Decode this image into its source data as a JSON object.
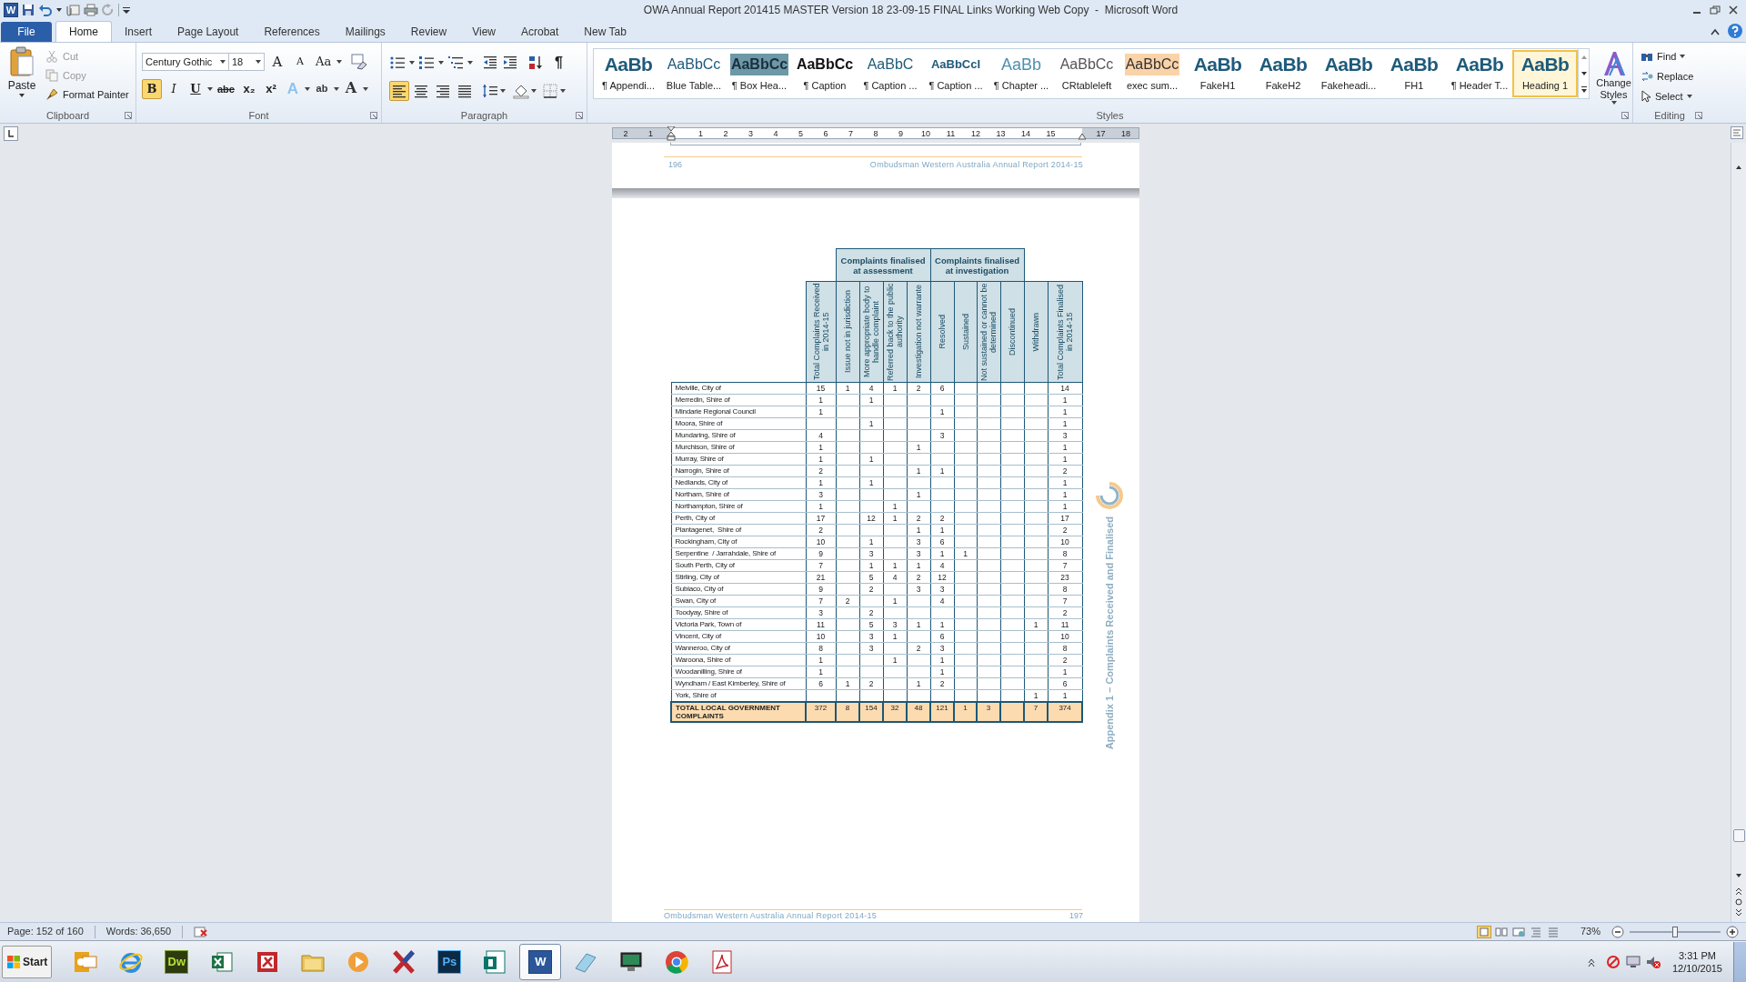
{
  "window": {
    "title": "OWA Annual Report 201415 MASTER Version 18 23-09-15 FINAL Links Working Web Copy  -  Microsoft Word",
    "app_glyph": "W"
  },
  "ribbon_tabs": [
    {
      "label": "File",
      "kind": "file",
      "selected": false
    },
    {
      "label": "Home",
      "kind": "tab",
      "selected": true
    },
    {
      "label": "Insert",
      "kind": "tab",
      "selected": false
    },
    {
      "label": "Page Layout",
      "kind": "tab",
      "selected": false
    },
    {
      "label": "References",
      "kind": "tab",
      "selected": false
    },
    {
      "label": "Mailings",
      "kind": "tab",
      "selected": false
    },
    {
      "label": "Review",
      "kind": "tab",
      "selected": false
    },
    {
      "label": "View",
      "kind": "tab",
      "selected": false
    },
    {
      "label": "Acrobat",
      "kind": "tab",
      "selected": false
    },
    {
      "label": "New Tab",
      "kind": "tab",
      "selected": false
    }
  ],
  "clipboard": {
    "label": "Clipboard",
    "paste": "Paste",
    "cut": "Cut",
    "copy": "Copy",
    "format_painter": "Format Painter"
  },
  "font": {
    "label": "Font",
    "name": "Century Gothic",
    "size": "18",
    "buttons": [
      {
        "kind": "grow",
        "label": "A",
        "on": false
      },
      {
        "kind": "shrink",
        "label": "A",
        "on": false
      },
      {
        "kind": "case",
        "label": "Aa",
        "on": false
      },
      {
        "kind": "bold",
        "label": "B",
        "on": true
      },
      {
        "kind": "italic",
        "label": "I",
        "on": false
      },
      {
        "kind": "underline",
        "label": "U",
        "on": false
      },
      {
        "kind": "strike",
        "label": "abc",
        "on": false
      },
      {
        "kind": "sub",
        "label": "x₂",
        "on": false
      },
      {
        "kind": "sup",
        "label": "x²",
        "on": false
      },
      {
        "kind": "effects",
        "label": "A",
        "on": false
      },
      {
        "kind": "highlight",
        "label": "ab",
        "on": false
      },
      {
        "kind": "color",
        "label": "A",
        "on": false
      }
    ]
  },
  "paragraph": {
    "label": "Paragraph",
    "pilcrow": "¶",
    "alignments": [
      {
        "kind": "left",
        "selected": true
      },
      {
        "kind": "center",
        "selected": false
      },
      {
        "kind": "right",
        "selected": false
      },
      {
        "kind": "justify",
        "selected": false
      }
    ]
  },
  "styles": {
    "label": "Styles",
    "change_styles": "Change Styles",
    "items": [
      {
        "preview": "AaBb",
        "name": "¶ Appendi...",
        "kind": "heading",
        "selected": false
      },
      {
        "preview": "AaBbCc",
        "name": "Blue Table...",
        "kind": "blue",
        "selected": false
      },
      {
        "preview": "AaBbCc",
        "name": "¶ Box Hea...",
        "kind": "box",
        "selected": false
      },
      {
        "preview": "AaBbCc",
        "name": "¶ Caption",
        "kind": "black",
        "selected": false
      },
      {
        "preview": "AaBbC",
        "name": "¶ Caption ...",
        "kind": "blue",
        "selected": false
      },
      {
        "preview": "AaBbCcI",
        "name": "¶ Caption ...",
        "kind": "small",
        "selected": false
      },
      {
        "preview": "AaBb",
        "name": "¶ Chapter ...",
        "kind": "light",
        "selected": false
      },
      {
        "preview": "AaBbCc",
        "name": "CRtableleft",
        "kind": "gray",
        "selected": false
      },
      {
        "preview": "AaBbCc",
        "name": "exec sum...",
        "kind": "peach",
        "selected": false
      },
      {
        "preview": "AaBb",
        "name": "FakeH1",
        "kind": "heading",
        "selected": false
      },
      {
        "preview": "AaBb",
        "name": "FakeH2",
        "kind": "heading",
        "selected": false
      },
      {
        "preview": "AaBb",
        "name": "Fakeheadi...",
        "kind": "heading",
        "selected": false
      },
      {
        "preview": "AaBb",
        "name": "FH1",
        "kind": "heading",
        "selected": false
      },
      {
        "preview": "AaBb",
        "name": "¶ Header T...",
        "kind": "heading",
        "selected": false
      },
      {
        "preview": "AaBb",
        "name": "Heading 1",
        "kind": "heading",
        "selected": true
      }
    ]
  },
  "editing": {
    "label": "Editing",
    "find": "Find",
    "replace": "Replace",
    "select": "Select"
  },
  "ruler": [
    "2",
    "1",
    "1",
    "2",
    "3",
    "4",
    "5",
    "6",
    "7",
    "8",
    "9",
    "10",
    "11",
    "12",
    "13",
    "14",
    "15",
    "17",
    "18"
  ],
  "previous_page": {
    "number": "196",
    "footer": "Ombudsman Western Australia Annual Report 2014-15"
  },
  "table": {
    "header": [
      {
        "kind": "single",
        "label": "Total  Complaints Received in 2014-15"
      },
      {
        "kind": "group",
        "label": "Complaints finalised at assessment",
        "columns": [
          "Issue not in jurisdiction",
          "More appropriate body to handle complaint",
          "Referred back to the public authority",
          "Investigation not warrante"
        ]
      },
      {
        "kind": "group",
        "label": "Complaints finalised at investigation",
        "columns": [
          "Resolved",
          "Sustained",
          "Not sustained or cannot be determined",
          "Discontinued"
        ]
      },
      {
        "kind": "single",
        "label": "Withdrawn"
      },
      {
        "kind": "single",
        "label": "Total  Complaints Finalised in 2014-15"
      }
    ],
    "rows": [
      {
        "name": "Melville, City of",
        "cells": [
          "15",
          "1",
          "4",
          "1",
          "2",
          "6",
          null,
          null,
          null,
          null,
          "14"
        ]
      },
      {
        "name": "Merredin, Shire of",
        "cells": [
          "1",
          null,
          "1",
          null,
          null,
          null,
          null,
          null,
          null,
          null,
          "1"
        ]
      },
      {
        "name": "Mindarie Regional Council",
        "cells": [
          "1",
          null,
          null,
          null,
          null,
          "1",
          null,
          null,
          null,
          null,
          "1"
        ]
      },
      {
        "name": "Moora, Shire of",
        "cells": [
          null,
          null,
          "1",
          null,
          null,
          null,
          null,
          null,
          null,
          null,
          "1"
        ]
      },
      {
        "name": "Mundaring, Shire of",
        "cells": [
          "4",
          null,
          null,
          null,
          null,
          "3",
          null,
          null,
          null,
          null,
          "3"
        ]
      },
      {
        "name": "Murchison, Shire of",
        "cells": [
          "1",
          null,
          null,
          null,
          "1",
          null,
          null,
          null,
          null,
          null,
          "1"
        ]
      },
      {
        "name": "Murray, Shire of",
        "cells": [
          "1",
          null,
          "1",
          null,
          null,
          null,
          null,
          null,
          null,
          null,
          "1"
        ]
      },
      {
        "name": "Narrogin, Shire of",
        "cells": [
          "2",
          null,
          null,
          null,
          "1",
          "1",
          null,
          null,
          null,
          null,
          "2"
        ]
      },
      {
        "name": "Nedlands, City of",
        "cells": [
          "1",
          null,
          "1",
          null,
          null,
          null,
          null,
          null,
          null,
          null,
          "1"
        ]
      },
      {
        "name": "Northam, Shire of",
        "cells": [
          "3",
          null,
          null,
          null,
          "1",
          null,
          null,
          null,
          null,
          null,
          "1"
        ]
      },
      {
        "name": "Northampton, Shire of",
        "cells": [
          "1",
          null,
          null,
          "1",
          null,
          null,
          null,
          null,
          null,
          null,
          "1"
        ]
      },
      {
        "name": "Perth, City of",
        "cells": [
          "17",
          null,
          "12",
          "1",
          "2",
          "2",
          null,
          null,
          null,
          null,
          "17"
        ]
      },
      {
        "name": "Plantagenet,  Shire of",
        "cells": [
          "2",
          null,
          null,
          null,
          "1",
          "1",
          null,
          null,
          null,
          null,
          "2"
        ]
      },
      {
        "name": "Rockingham, City of",
        "cells": [
          "10",
          null,
          "1",
          null,
          "3",
          "6",
          null,
          null,
          null,
          null,
          "10"
        ]
      },
      {
        "name": "Serpentine  / Jarrahdale, Shire of",
        "cells": [
          "9",
          null,
          "3",
          null,
          "3",
          "1",
          "1",
          null,
          null,
          null,
          "8"
        ]
      },
      {
        "name": "South Perth, City of",
        "cells": [
          "7",
          null,
          "1",
          "1",
          "1",
          "4",
          null,
          null,
          null,
          null,
          "7"
        ]
      },
      {
        "name": "Stirling, City of",
        "cells": [
          "21",
          null,
          "5",
          "4",
          "2",
          "12",
          null,
          null,
          null,
          null,
          "23"
        ]
      },
      {
        "name": "Subiaco, City of",
        "cells": [
          "9",
          null,
          "2",
          null,
          "3",
          "3",
          null,
          null,
          null,
          null,
          "8"
        ]
      },
      {
        "name": "Swan, City of",
        "cells": [
          "7",
          "2",
          null,
          "1",
          null,
          "4",
          null,
          null,
          null,
          null,
          "7"
        ]
      },
      {
        "name": "Toodyay, Shire of",
        "cells": [
          "3",
          null,
          "2",
          null,
          null,
          null,
          null,
          null,
          null,
          null,
          "2"
        ]
      },
      {
        "name": "Victoria Park, Town of",
        "cells": [
          "11",
          null,
          "5",
          "3",
          "1",
          "1",
          null,
          null,
          null,
          "1",
          "11"
        ]
      },
      {
        "name": "Vincent, City of",
        "cells": [
          "10",
          null,
          "3",
          "1",
          null,
          "6",
          null,
          null,
          null,
          null,
          "10"
        ]
      },
      {
        "name": "Wanneroo, City of",
        "cells": [
          "8",
          null,
          "3",
          null,
          "2",
          "3",
          null,
          null,
          null,
          null,
          "8"
        ]
      },
      {
        "name": "Waroona, Shire of",
        "cells": [
          "1",
          null,
          null,
          "1",
          null,
          "1",
          null,
          null,
          null,
          null,
          "2"
        ]
      },
      {
        "name": "Woodanilling, Shire of",
        "cells": [
          "1",
          null,
          null,
          null,
          null,
          "1",
          null,
          null,
          null,
          null,
          "1"
        ]
      },
      {
        "name": "Wyndham / East Kimberley, Shire of",
        "cells": [
          "6",
          "1",
          "2",
          null,
          "1",
          "2",
          null,
          null,
          null,
          null,
          "6"
        ]
      },
      {
        "name": "York, Shire of",
        "cells": [
          null,
          null,
          null,
          null,
          null,
          null,
          null,
          null,
          null,
          "1",
          "1"
        ]
      }
    ],
    "total": {
      "name": "TOTAL LOCAL GOVERNMENT COMPLAINTS",
      "cells": [
        "372",
        "8",
        "154",
        "32",
        "48",
        "121",
        "1",
        "3",
        null,
        "7",
        "374"
      ]
    }
  },
  "side_title": "Appendix 1 – Complaints Received and Finalised",
  "footer": {
    "text": "Ombudsman Western Australia Annual Report 2014-15",
    "number": "197"
  },
  "status_bar": {
    "page": "Page: 152 of 160",
    "words": "Words: 36,650",
    "zoom": "73%",
    "level": 0.5
  },
  "taskbar": {
    "start": "Start",
    "time": "3:31 PM",
    "date": "12/10/2015",
    "apps": [
      {
        "kind": "outlook",
        "selected": false
      },
      {
        "kind": "ie",
        "selected": false
      },
      {
        "kind": "dreamweaver",
        "glyph": "Dw",
        "selected": false
      },
      {
        "kind": "excel",
        "selected": false
      },
      {
        "kind": "access",
        "selected": false
      },
      {
        "kind": "folder",
        "selected": false
      },
      {
        "kind": "media",
        "selected": false
      },
      {
        "kind": "xapp",
        "selected": false
      },
      {
        "kind": "photoshop",
        "glyph": "Ps",
        "selected": false
      },
      {
        "kind": "publisher",
        "selected": false
      },
      {
        "kind": "word",
        "glyph": "W",
        "selected": true
      },
      {
        "kind": "notepad",
        "selected": false
      },
      {
        "kind": "monitor",
        "selected": false
      },
      {
        "kind": "chrome",
        "selected": false
      },
      {
        "kind": "acrobat",
        "selected": false
      }
    ]
  }
}
